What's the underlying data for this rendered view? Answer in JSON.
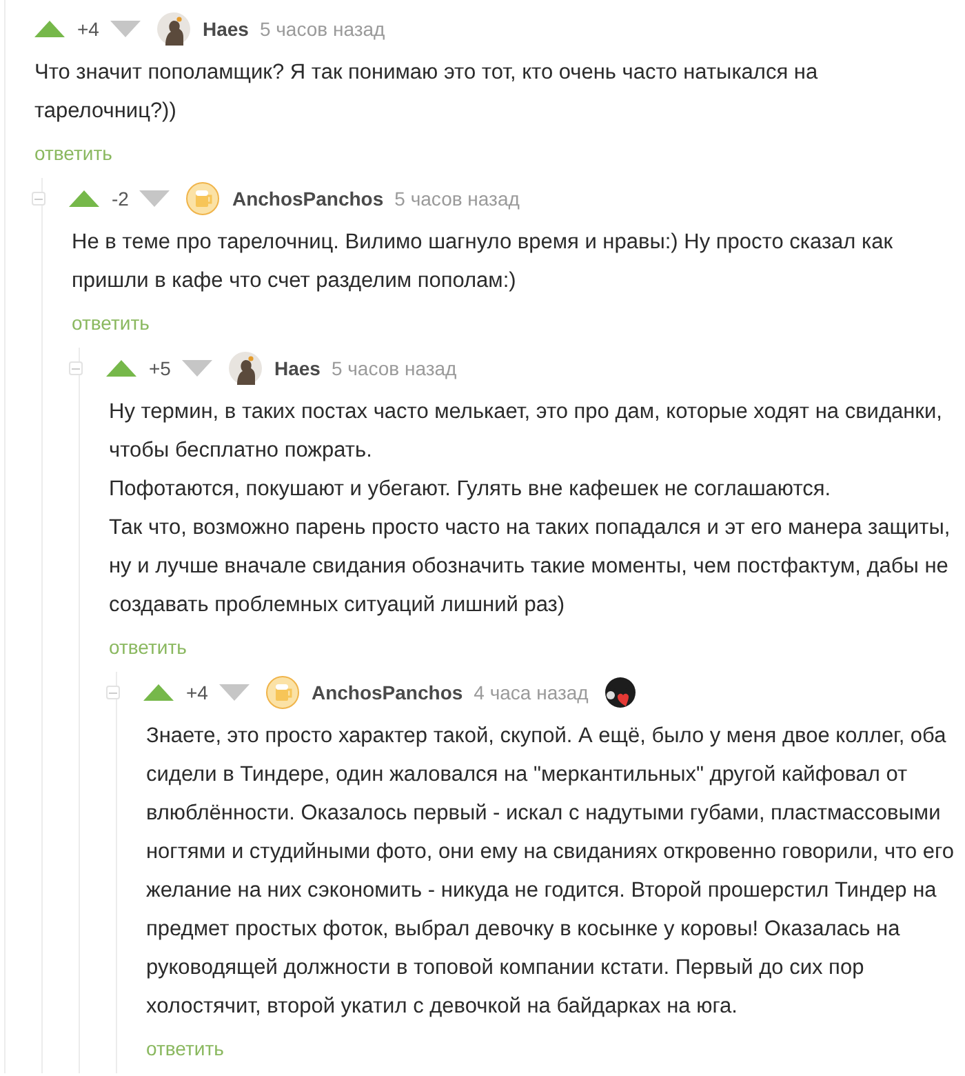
{
  "comments": [
    {
      "score": "+4",
      "author": "Haes",
      "time": "5 часов назад",
      "avatar": {
        "kind": "figure"
      },
      "paragraphs": [
        "Что значит пополамщик? Я так понимаю это тот, кто очень часто натыкался на тарелочниц?))"
      ],
      "reply": "ответить",
      "children": [
        {
          "score": "-2",
          "author": "AnchosPanchos",
          "time": "5 часов назад",
          "avatar": {
            "kind": "mug"
          },
          "paragraphs": [
            "Не в теме про тарелочниц. Вилимо шагнуло время и нравы:) Ну просто сказал как пришли в кафе что счет разделим пополам:)"
          ],
          "reply": "ответить",
          "children": [
            {
              "score": "+5",
              "author": "Haes",
              "time": "5 часов назад",
              "avatar": {
                "kind": "figure"
              },
              "paragraphs": [
                "Ну термин, в таких постах часто мелькает, это про дам, которые ходят на свиданки, чтобы бесплатно пожрать.",
                "Пофотаются, покушают и убегают. Гулять вне кафешек не соглашаются.",
                "Так что, возможно парень просто часто на таких попадался и эт его манера защиты, ну и лучше вначале свидания обозначить такие моменты, чем постфактум, дабы не создавать проблемных ситуаций лишний раз)"
              ],
              "reply": "ответить",
              "children": [
                {
                  "score": "+4",
                  "author": "AnchosPanchos",
                  "time": "4 часа назад",
                  "avatar": {
                    "kind": "mug"
                  },
                  "badge": {
                    "kind": "cat-heart"
                  },
                  "paragraphs": [
                    "Знаете, это просто характер такой, скупой. А ещё, было у меня двое коллег, оба сидели в Тиндере, один жаловался на \"меркантильных\" другой кайфовал от влюблённости. Оказалось первый - искал с надутыми губами, пластмассовыми ногтями и студийными фото, они ему на свиданиях откровенно говорили, что его желание на них сэкономить - никуда не годится. Второй прошерстил Тиндер на предмет простых фоток, выбрал девочку в косынке у коровы! Оказалась на руководящей должности в топовой компании кстати. Первый до сих пор холостячит, второй укатил с девочкой на байдарках на юга."
                  ],
                  "reply": "ответить"
                }
              ]
            }
          ]
        }
      ]
    }
  ]
}
